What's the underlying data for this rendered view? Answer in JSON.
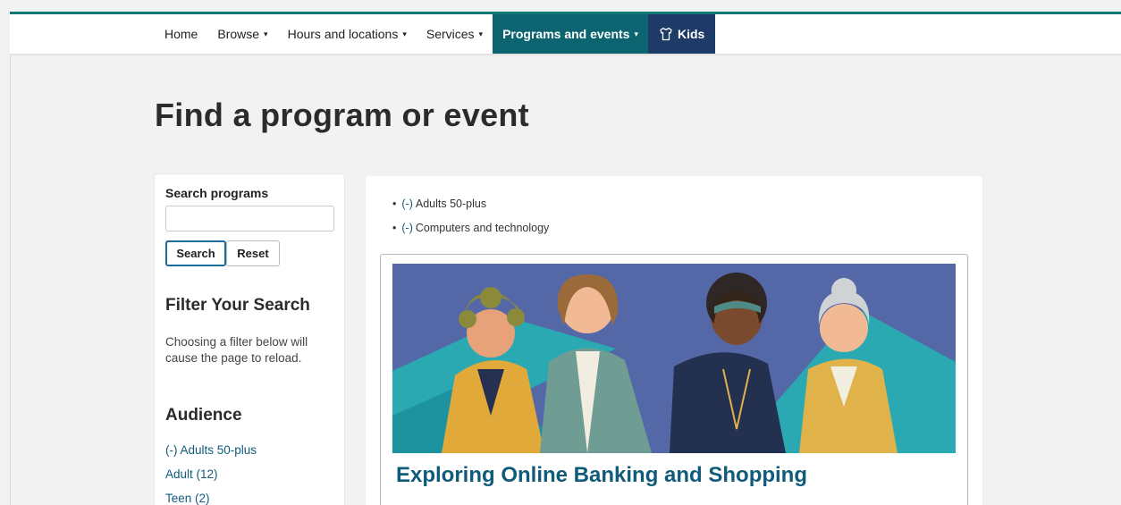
{
  "nav": {
    "items": [
      {
        "label": "Home",
        "dropdown": false
      },
      {
        "label": "Browse",
        "dropdown": true
      },
      {
        "label": "Hours and locations",
        "dropdown": true
      },
      {
        "label": "Services",
        "dropdown": true
      },
      {
        "label": "Programs and events",
        "dropdown": true,
        "active": true
      }
    ],
    "kids": {
      "label": "Kids",
      "icon": "shirt-icon"
    },
    "caret": "▾",
    "accent": "#0b6470",
    "kids_color": "#1e3b68"
  },
  "page": {
    "title": "Find a program or event"
  },
  "sidebar": {
    "search_label": "Search programs",
    "search_value": "",
    "search_button": "Search",
    "reset_button": "Reset",
    "filter_heading": "Filter Your Search",
    "filter_note": "Choosing a filter below will cause the page to reload.",
    "audience_heading": "Audience",
    "audience_items": [
      "(-) Adults 50-plus",
      "Adult (12)",
      "Teen (2)"
    ]
  },
  "active_filters": [
    {
      "remove": "(-)",
      "label": "Adults 50-plus"
    },
    {
      "remove": "(-)",
      "label": "Computers and technology"
    }
  ],
  "card": {
    "title": "Exploring Online Banking and Shopping",
    "image_alt": "Illustration of four smiling older women standing together"
  }
}
